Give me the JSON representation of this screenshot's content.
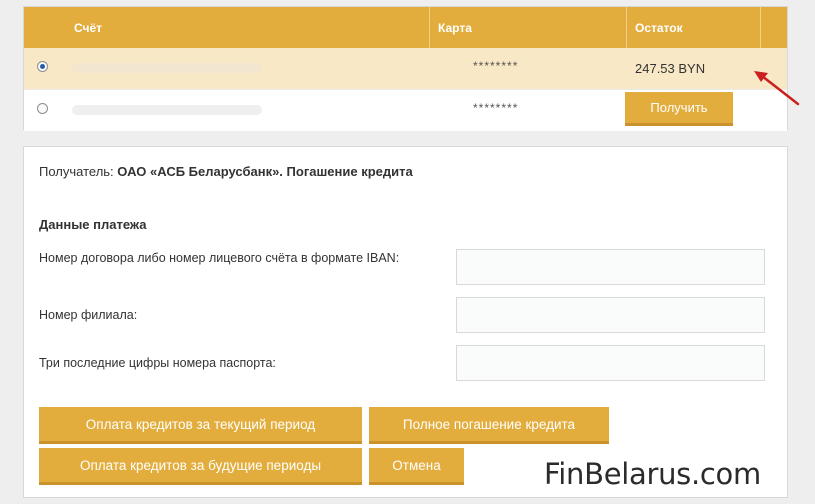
{
  "accounts_table": {
    "headers": {
      "account": "Счёт",
      "card": "Карта",
      "balance": "Остаток"
    },
    "rows": [
      {
        "selected": true,
        "card_mask": "********",
        "balance": "247.53 BYN"
      },
      {
        "selected": false,
        "card_mask": "********",
        "action_label": "Получить"
      }
    ]
  },
  "payment": {
    "recipient_label": "Получатель:",
    "recipient_value": "ОАО «АСБ Беларусбанк». Погашение кредита",
    "section_title": "Данные платежа",
    "fields": [
      {
        "label": "Номер договора либо номер лицевого счёта в формате IBAN:",
        "value": ""
      },
      {
        "label": "Номер филиала:",
        "value": ""
      },
      {
        "label": "Три последние цифры номера паспорта:",
        "value": ""
      }
    ],
    "buttons": {
      "pay_current": "Оплата кредитов за текущий период",
      "full_repay": "Полное погашение кредита",
      "pay_future": "Оплата кредитов за будущие периоды",
      "cancel": "Отмена"
    }
  },
  "watermark": "FinBelarus.com",
  "colors": {
    "accent": "#e2ad3d",
    "selected_row": "#f8e8c5",
    "arrow": "#cc1f1f"
  }
}
